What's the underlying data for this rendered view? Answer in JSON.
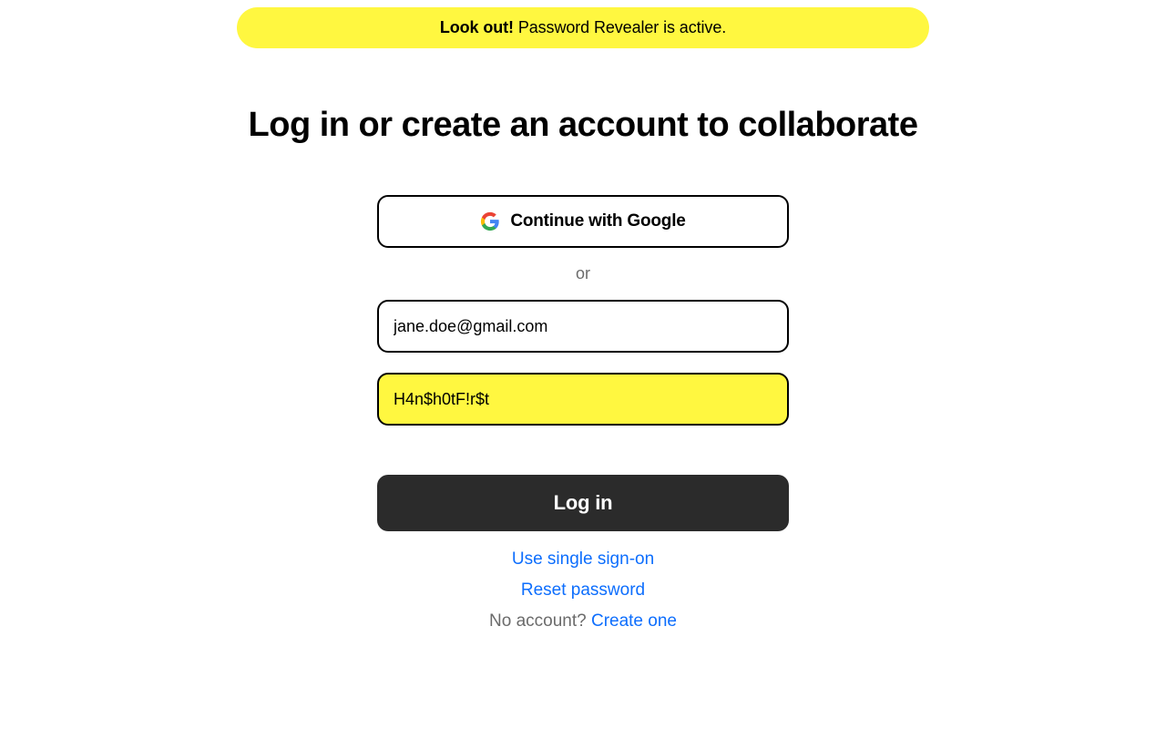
{
  "alert": {
    "strong": "Look out!",
    "text": " Password Revealer is active."
  },
  "heading": "Log in or create an account to collaborate",
  "google_button_label": "Continue with Google",
  "divider": "or",
  "email": {
    "value": "jane.doe@gmail.com"
  },
  "password": {
    "value": "H4n$h0tF!r$t"
  },
  "login_button_label": "Log in",
  "sso_link": "Use single sign-on",
  "reset_link": "Reset password",
  "no_account_text": "No account? ",
  "create_link": "Create one"
}
